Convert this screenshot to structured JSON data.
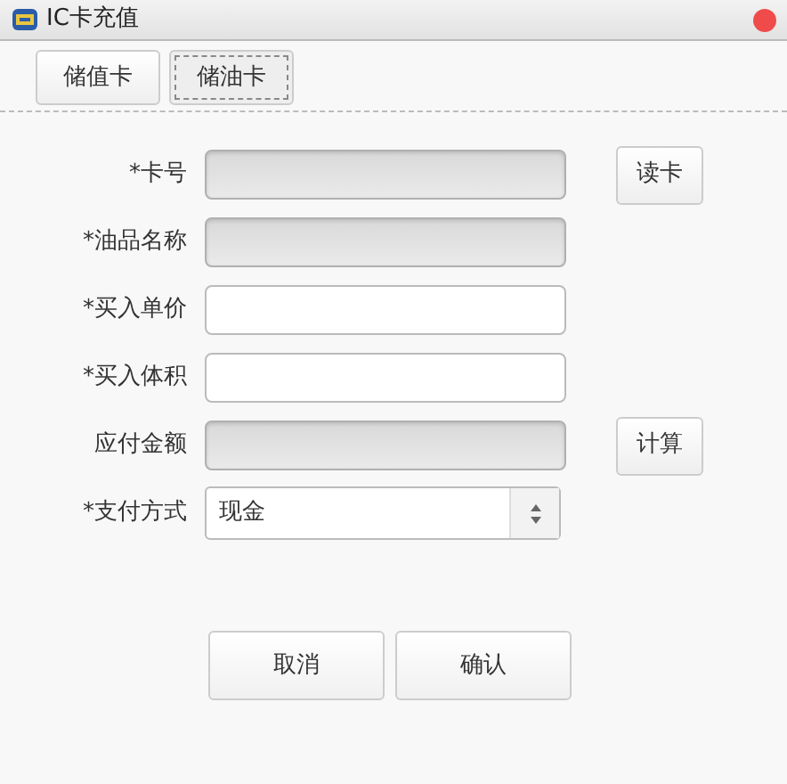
{
  "window": {
    "title": "IC卡充值"
  },
  "tabs": [
    {
      "label": "储值卡",
      "selected": false
    },
    {
      "label": "储油卡",
      "selected": true
    }
  ],
  "fields": [
    {
      "label": "*卡号",
      "kind": "input",
      "disabled": true,
      "button": "读卡"
    },
    {
      "label": "*油品名称",
      "kind": "input",
      "disabled": true
    },
    {
      "label": "*买入单价",
      "kind": "input",
      "disabled": false
    },
    {
      "label": "*买入体积",
      "kind": "input",
      "disabled": false
    },
    {
      "label": "应付金额",
      "kind": "input",
      "disabled": true,
      "button": "计算"
    },
    {
      "label": "*支付方式",
      "kind": "select",
      "value": "现金"
    }
  ],
  "buttons": [
    "取消",
    "确认"
  ]
}
